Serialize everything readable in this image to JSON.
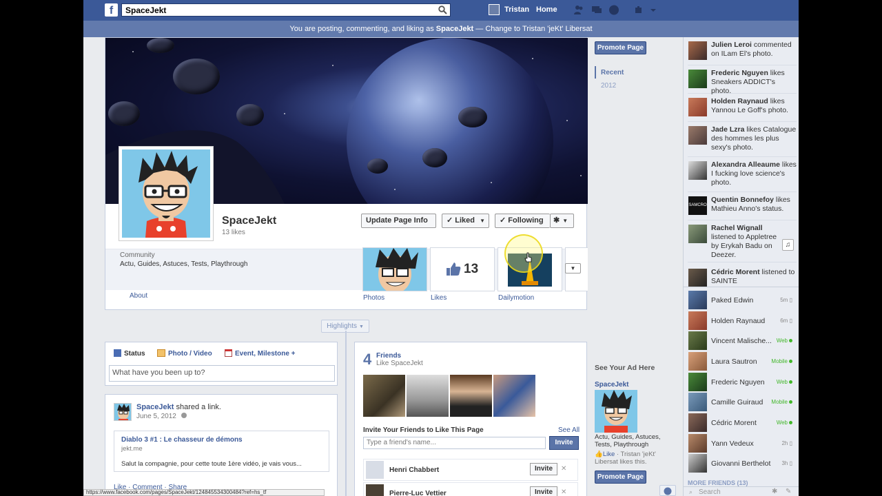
{
  "topbar": {
    "logo": "f",
    "search_value": "SpaceJekt",
    "user_name": "Tristan",
    "home": "Home"
  },
  "notice": {
    "prefix": "You are posting, commenting, and liking as ",
    "page": "SpaceJekt",
    "sep": " — ",
    "change": "Change to Tristan 'jeKt' Libersat"
  },
  "profile": {
    "name": "SpaceJekt",
    "likes": "13 likes",
    "category": "Community",
    "description": "Actu, Guides, Astuces, Tests, Playthrough",
    "about": "About"
  },
  "buttons": {
    "update_info": "Update Page Info",
    "liked": "Liked",
    "following": "Following"
  },
  "apps": [
    {
      "label": "Photos"
    },
    {
      "label": "Likes",
      "count": "13"
    },
    {
      "label": "Dailymotion"
    }
  ],
  "highlights": "Highlights",
  "composer": {
    "tabs": [
      "Status",
      "Photo / Video",
      "Event, Milestone +"
    ],
    "placeholder": "What have you been up to?"
  },
  "post": {
    "author": "SpaceJekt",
    "action": " shared a link.",
    "date": "June 5, 2012",
    "link_title": "Diablo 3 #1 : Le chasseur de démons",
    "link_domain": "jekt.me",
    "link_desc": "Salut la compagnie, pour cette toute 1ère vidéo, je vais vous...",
    "actions": "Like · Comment · Share"
  },
  "friends_box": {
    "count": "4",
    "title": "Friends",
    "subtitle": "Like SpaceJekt",
    "invite_heading": "Invite Your Friends to Like This Page",
    "see_all": "See All",
    "invite_placeholder": "Type a friend's name...",
    "invite_button": "Invite",
    "rows": [
      {
        "name": "Henri Chabbert",
        "button": "Invite"
      },
      {
        "name": "Pierre-Luc Vettier",
        "button": "Invite"
      }
    ]
  },
  "right_col": {
    "promote": "Promote Page",
    "years": [
      "Recent",
      "2012"
    ],
    "ad_heading": "See Your Ad Here",
    "ad_page": "SpaceJekt",
    "ad_desc": "Actu, Guides, Astuces, Tests, Playthrough",
    "ad_like": "Like",
    "ad_like_text": " · Tristan 'jeKt' Libersat likes this.",
    "promote2": "Promote Page"
  },
  "ticker": [
    {
      "name": "Julien Leroi",
      "text": " commented on ILam El's photo."
    },
    {
      "name": "Frederic Nguyen",
      "text": " likes Sneakers ADDICT's photo."
    },
    {
      "name": "Holden Raynaud",
      "text": " likes Yannou Le Goff's photo."
    },
    {
      "name": "Jade Lzra",
      "text": " likes Catalogue des hommes les plus sexy's photo."
    },
    {
      "name": "Alexandra Alleaume",
      "text": " likes I fucking love science's photo."
    },
    {
      "name": "Quentin Bonnefoy",
      "text": " likes Mathieu Anno's status."
    },
    {
      "name": "Rachel Wignall",
      "text": " listened to Appletree by Erykah Badu on Deezer."
    },
    {
      "name": "Cédric Morent",
      "text": " listened to SAINTE"
    }
  ],
  "ticker_avatar_label": "SAMCRO",
  "chat": [
    {
      "name": "Paked Edwin",
      "status": "5m"
    },
    {
      "name": "Holden Raynaud",
      "status": "6m"
    },
    {
      "name": "Vincent Malische...",
      "status": "Web"
    },
    {
      "name": "Laura Sautron",
      "status": "Mobile"
    },
    {
      "name": "Frederic Nguyen",
      "status": "Web"
    },
    {
      "name": "Camille Guiraud",
      "status": "Mobile"
    },
    {
      "name": "Cédric Morent",
      "status": "Web"
    },
    {
      "name": "Yann Vedeux",
      "status": "2h"
    },
    {
      "name": "Giovanni Berthelot",
      "status": "3h"
    }
  ],
  "chat_more": "MORE FRIENDS (13)",
  "chat_search": "Search",
  "status_url": "https://www.facebook.com/pages/SpaceJekt/124845534300484?ref=hs_tf"
}
